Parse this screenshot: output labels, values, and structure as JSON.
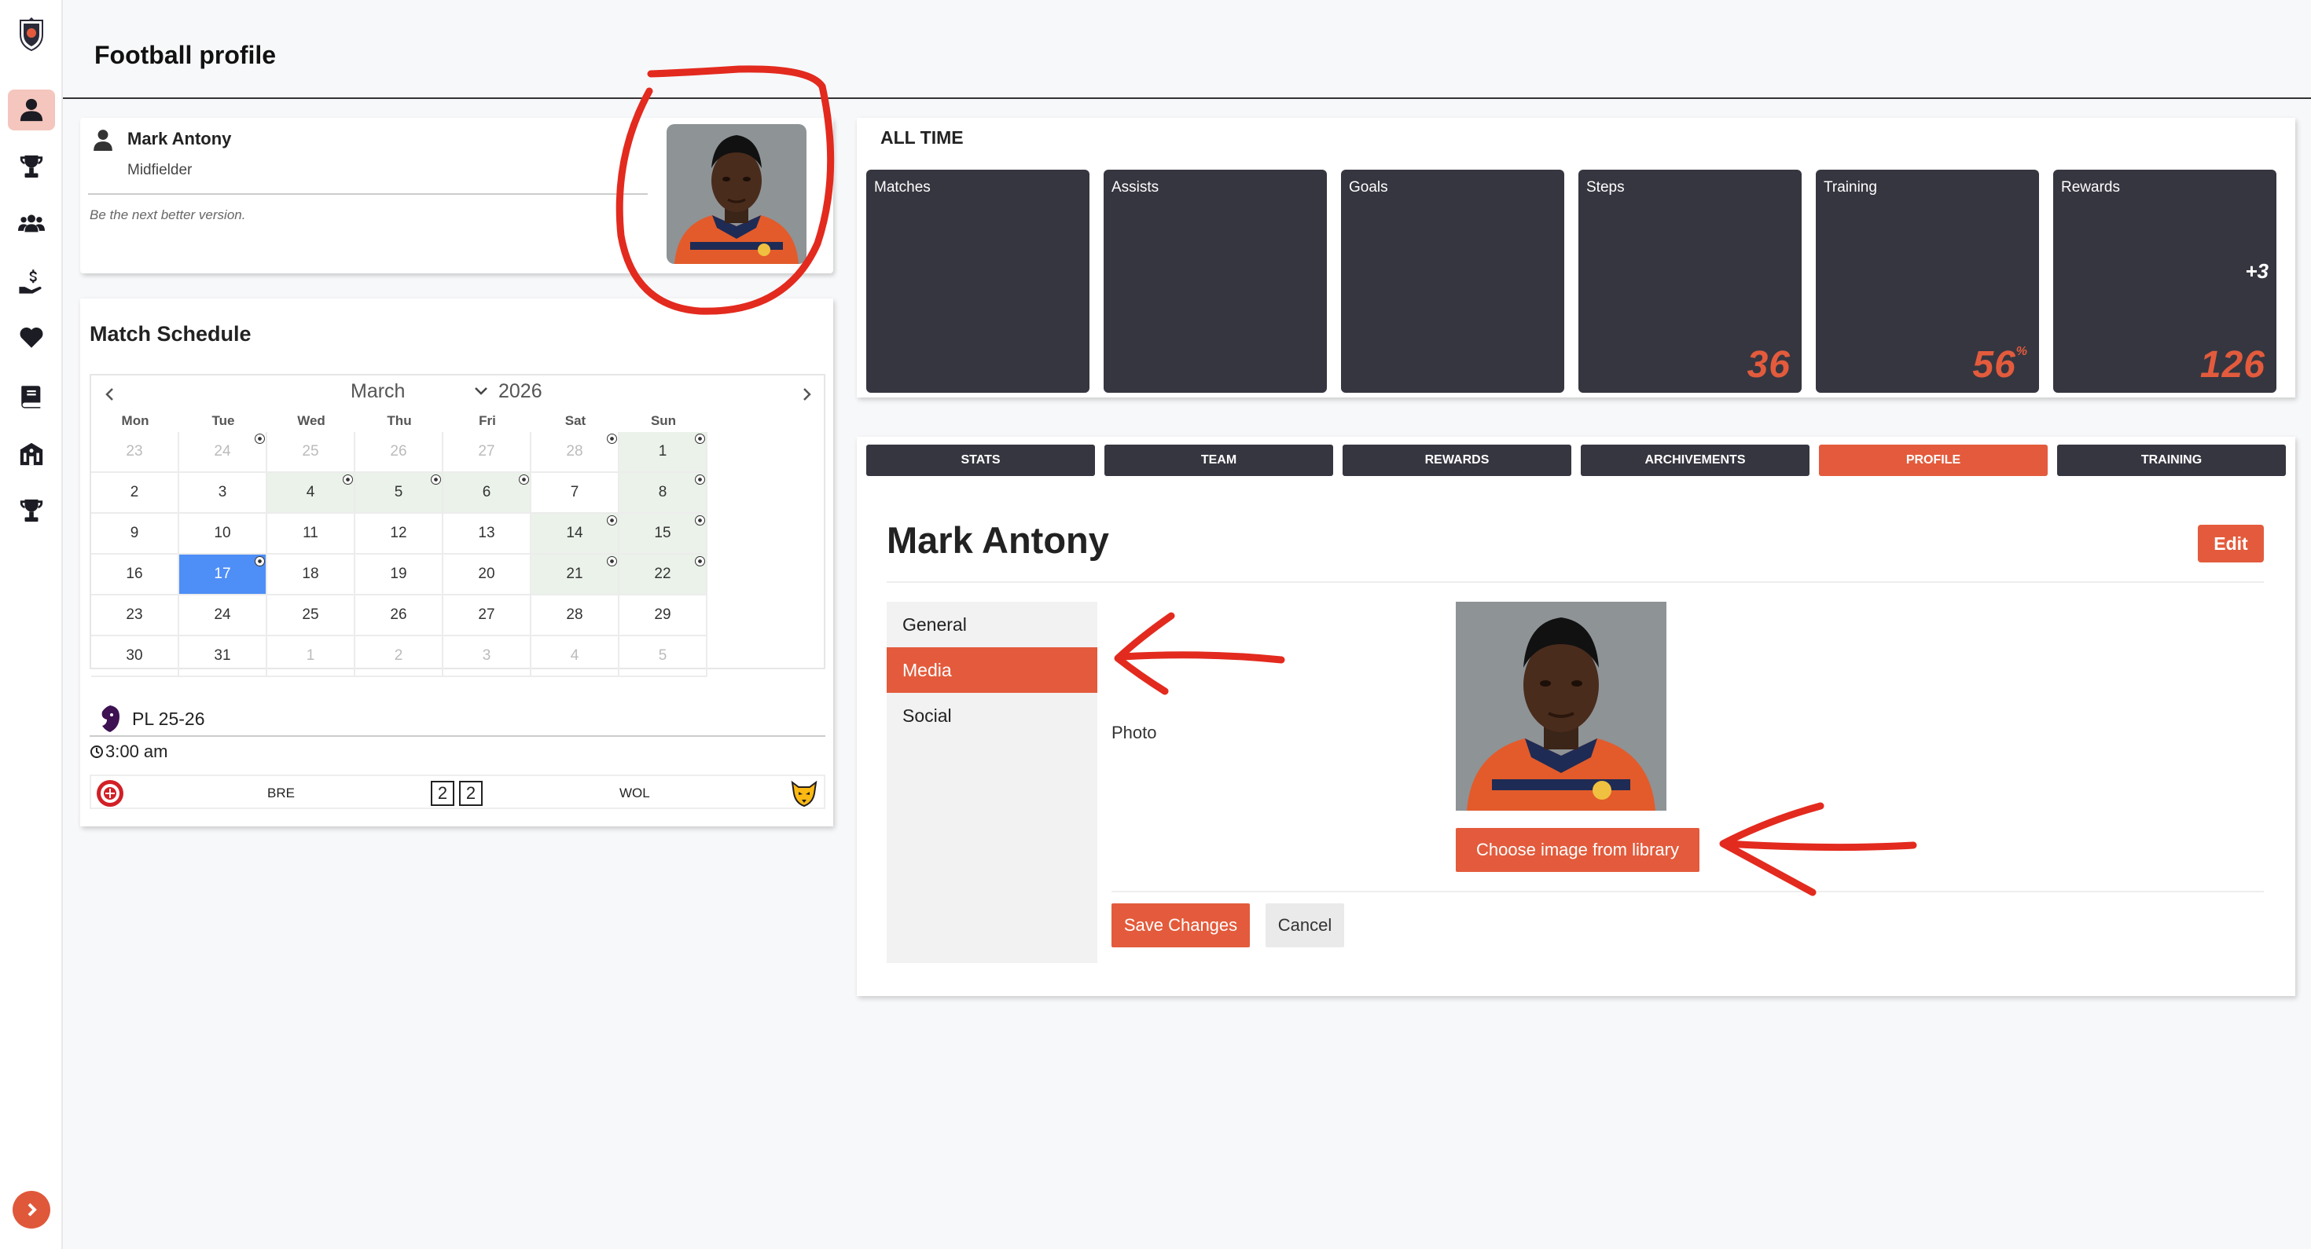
{
  "header": {
    "title": "Football profile"
  },
  "sidebar": {
    "items": [
      {
        "name": "profile-icon",
        "active": true
      },
      {
        "name": "trophy-icon",
        "active": false
      },
      {
        "name": "team-icon",
        "active": false
      },
      {
        "name": "donate-icon",
        "active": false
      },
      {
        "name": "heart-icon",
        "active": false
      },
      {
        "name": "book-icon",
        "active": false
      },
      {
        "name": "academy-icon",
        "active": false
      },
      {
        "name": "cup-icon",
        "active": false
      }
    ]
  },
  "player": {
    "name": "Mark Antony",
    "position": "Midfielder",
    "motto": "Be the next better version."
  },
  "schedule": {
    "title": "Match Schedule",
    "month": "March",
    "year": "2026",
    "dows": [
      "Mon",
      "Tue",
      "Wed",
      "Thu",
      "Fri",
      "Sat",
      "Sun"
    ],
    "days": [
      {
        "d": "23",
        "o": true
      },
      {
        "d": "24",
        "o": true,
        "b": true
      },
      {
        "d": "25",
        "o": true
      },
      {
        "d": "26",
        "o": true
      },
      {
        "d": "27",
        "o": true
      },
      {
        "d": "28",
        "o": true,
        "b": true
      },
      {
        "d": "1",
        "m": true,
        "b": true
      },
      {
        "d": "2"
      },
      {
        "d": "3"
      },
      {
        "d": "4",
        "m": true,
        "b": true
      },
      {
        "d": "5",
        "m": true,
        "b": true
      },
      {
        "d": "6",
        "m": true,
        "b": true
      },
      {
        "d": "7"
      },
      {
        "d": "8",
        "m": true,
        "b": true
      },
      {
        "d": "9"
      },
      {
        "d": "10"
      },
      {
        "d": "11"
      },
      {
        "d": "12"
      },
      {
        "d": "13"
      },
      {
        "d": "14",
        "m": true,
        "b": true
      },
      {
        "d": "15",
        "m": true,
        "b": true
      },
      {
        "d": "16"
      },
      {
        "d": "17",
        "s": true,
        "b": true
      },
      {
        "d": "18"
      },
      {
        "d": "19"
      },
      {
        "d": "20"
      },
      {
        "d": "21",
        "m": true,
        "b": true
      },
      {
        "d": "22",
        "m": true,
        "b": true
      },
      {
        "d": "23"
      },
      {
        "d": "24"
      },
      {
        "d": "25"
      },
      {
        "d": "26"
      },
      {
        "d": "27"
      },
      {
        "d": "28"
      },
      {
        "d": "29"
      },
      {
        "d": "30"
      },
      {
        "d": "31"
      },
      {
        "d": "1",
        "o": true
      },
      {
        "d": "2",
        "o": true
      },
      {
        "d": "3",
        "o": true
      },
      {
        "d": "4",
        "o": true
      },
      {
        "d": "5",
        "o": true
      }
    ],
    "league": "PL 25-26",
    "time": "3:00 am",
    "match": {
      "home": "BRE",
      "away": "WOL",
      "home_score": "2",
      "away_score": "2"
    }
  },
  "alltime": {
    "title": "ALL TIME",
    "stats": [
      {
        "label": "Matches",
        "value": "",
        "bonus": ""
      },
      {
        "label": "Assists",
        "value": "",
        "bonus": ""
      },
      {
        "label": "Goals",
        "value": "",
        "bonus": ""
      },
      {
        "label": "Steps",
        "value": "36",
        "bonus": ""
      },
      {
        "label": "Training",
        "value": "56",
        "suffix": "%",
        "bonus": ""
      },
      {
        "label": "Rewards",
        "value": "126",
        "bonus": "+3"
      }
    ]
  },
  "profile": {
    "tabs": [
      {
        "label": "STATS",
        "active": false
      },
      {
        "label": "TEAM",
        "active": false
      },
      {
        "label": "REWARDS",
        "active": false
      },
      {
        "label": "ARCHIVEMENTS",
        "active": false
      },
      {
        "label": "PROFILE",
        "active": true
      },
      {
        "label": "TRAINING",
        "active": false
      }
    ],
    "name": "Mark Antony",
    "edit_label": "Edit",
    "subnav": [
      {
        "label": "General",
        "active": false
      },
      {
        "label": "Media",
        "active": true
      },
      {
        "label": "Social",
        "active": false
      }
    ],
    "photo_label": "Photo",
    "choose_label": "Choose image from library",
    "save_label": "Save Changes",
    "cancel_label": "Cancel"
  },
  "colors": {
    "accent": "#e35b3c",
    "tile": "#363640",
    "selected_day": "#4e8ef7",
    "annotation": "#e32a1e"
  }
}
